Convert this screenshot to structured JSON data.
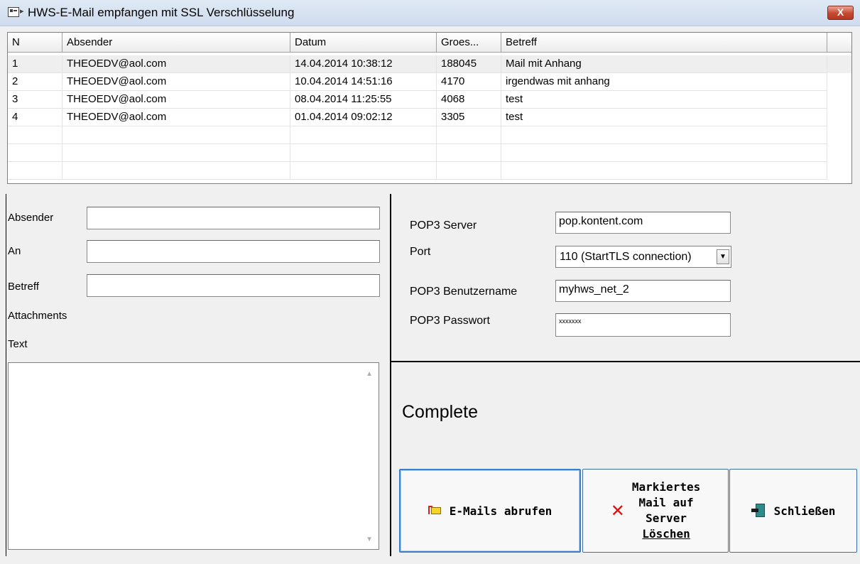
{
  "window": {
    "title": "HWS-E-Mail empfangen mit SSL Verschlüsselung",
    "close_label": "X"
  },
  "mail_list": {
    "columns": [
      "N",
      "Absender",
      "Datum",
      "Groes...",
      "Betreff"
    ],
    "rows": [
      {
        "n": "1",
        "sender": "THEOEDV@aol.com",
        "date": "14.04.2014 10:38:12",
        "size": "188045",
        "subject": "Mail mit Anhang"
      },
      {
        "n": "2",
        "sender": "THEOEDV@aol.com",
        "date": "10.04.2014 14:51:16",
        "size": "4170",
        "subject": "irgendwas mit anhang"
      },
      {
        "n": "3",
        "sender": "THEOEDV@aol.com",
        "date": "08.04.2014 11:25:55",
        "size": "4068",
        "subject": "test"
      },
      {
        "n": "4",
        "sender": "THEOEDV@aol.com",
        "date": "01.04.2014 09:02:12",
        "size": "3305",
        "subject": "test"
      }
    ]
  },
  "message": {
    "sender_label": "Absender",
    "sender_value": "",
    "to_label": "An",
    "to_value": "",
    "subject_label": "Betreff",
    "subject_value": "",
    "attachments_label": "Attachments",
    "text_label": "Text"
  },
  "server": {
    "pop3_server_label": "POP3 Server",
    "pop3_server_value": "pop.kontent.com",
    "port_label": "Port",
    "port_value": "110 (StartTLS connection)",
    "username_label": "POP3 Benutzername",
    "username_value": "myhws_net_2",
    "password_label": "POP3 Passwort",
    "password_value": "xxxxxxx"
  },
  "status": {
    "text": "Complete"
  },
  "buttons": {
    "fetch": "E-Mails abrufen",
    "delete_line1": "Markiertes",
    "delete_line2": "Mail auf",
    "delete_line3": "Server",
    "delete_line4": "Löschen",
    "close": "Schließen"
  },
  "icons": {
    "app": "app-window-icon",
    "fetch": "mail-fetch-icon",
    "delete": "red-x-icon",
    "close": "exit-door-icon"
  }
}
